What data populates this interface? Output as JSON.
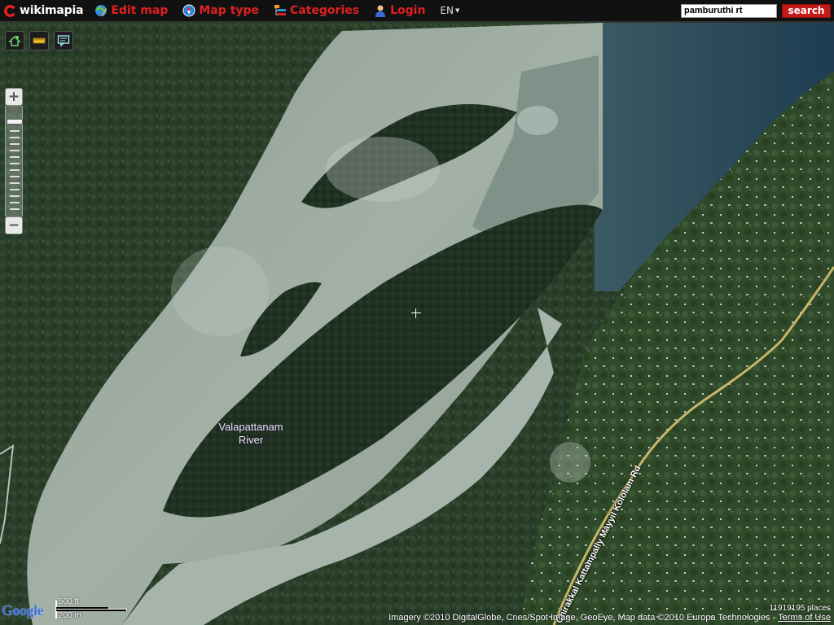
{
  "header": {
    "logo_text": "wikimapia",
    "menu": [
      {
        "label": "Edit map",
        "icon": "edit-map-icon"
      },
      {
        "label": "Map type",
        "icon": "compass-icon"
      },
      {
        "label": "Categories",
        "icon": "categories-icon"
      },
      {
        "label": "Login",
        "icon": "user-icon"
      }
    ],
    "language": "EN",
    "search": {
      "value": "pamburuthi rt",
      "button_label": "search"
    }
  },
  "map": {
    "tools": [
      "home-icon",
      "ruler-icon",
      "comment-icon"
    ],
    "zoom": {
      "plus": "+",
      "minus": "−"
    },
    "labels": {
      "river_line1": "Valapattanam",
      "river_line2": "River",
      "road": "Chirakkal Kattampally Mayyil Kololam Rd"
    },
    "scale": {
      "feet": "500 ft",
      "meters": "200 m"
    },
    "places_count": "11919195 places",
    "attribution": "Imagery ©2010 DigitalGlobe, Cnes/Spot Image, GeoEye, Map data ©2010 Europa Technologies -",
    "terms_label": "Terms of Use",
    "google_logo": "Google"
  },
  "colors": {
    "toolbar_bg": "#111111",
    "menu_text": "#e02020",
    "search_button": "#c21a1a"
  }
}
